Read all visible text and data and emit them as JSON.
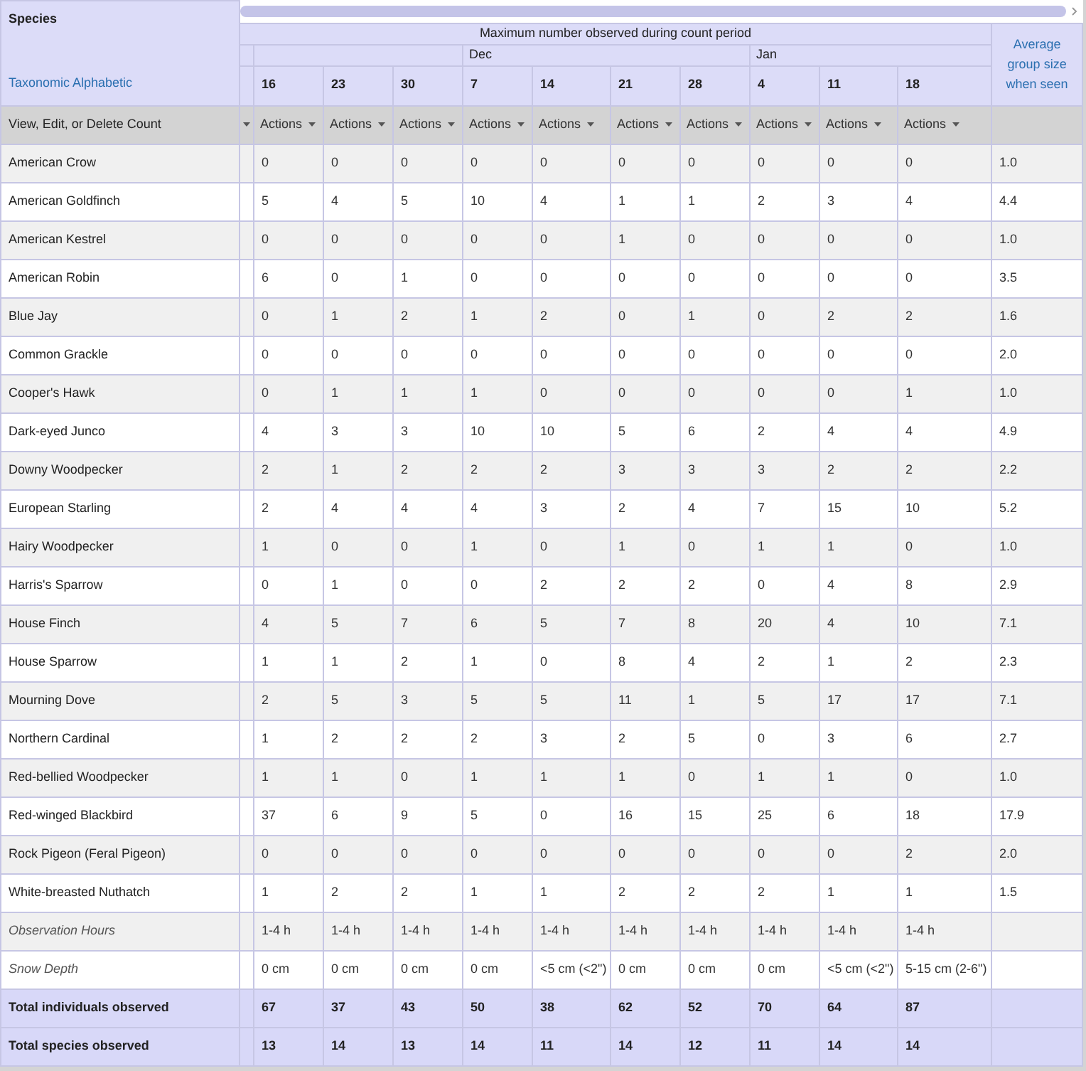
{
  "header": {
    "species_label": "Species",
    "sort_link": "Taxonomic Alphabetic",
    "group_title": "Maximum number observed during count period",
    "date_groups": [
      {
        "dates": [
          "16",
          "23",
          "30"
        ]
      },
      {
        "month": "Dec",
        "dates": [
          "7",
          "14",
          "21",
          "28"
        ]
      },
      {
        "month": "Jan",
        "dates": [
          "4",
          "11",
          "18"
        ]
      }
    ],
    "average_label": "Average group size when seen",
    "actions_label": "View, Edit, or Delete Count",
    "action_buttons": [
      "Actions",
      "Actions",
      "Actions",
      "Actions",
      "Actions",
      "Actions",
      "Actions",
      "Actions",
      "Actions",
      "Actions"
    ]
  },
  "rows": [
    {
      "kind": "species",
      "name": "American Crow",
      "values": [
        "0",
        "0",
        "0",
        "0",
        "0",
        "0",
        "0",
        "0",
        "0",
        "0"
      ],
      "average": "1.0"
    },
    {
      "kind": "species",
      "name": "American Goldfinch",
      "values": [
        "5",
        "4",
        "5",
        "10",
        "4",
        "1",
        "1",
        "2",
        "3",
        "4"
      ],
      "average": "4.4"
    },
    {
      "kind": "species",
      "name": "American Kestrel",
      "values": [
        "0",
        "0",
        "0",
        "0",
        "0",
        "1",
        "0",
        "0",
        "0",
        "0"
      ],
      "average": "1.0"
    },
    {
      "kind": "species",
      "name": "American Robin",
      "values": [
        "6",
        "0",
        "1",
        "0",
        "0",
        "0",
        "0",
        "0",
        "0",
        "0"
      ],
      "average": "3.5"
    },
    {
      "kind": "species",
      "name": "Blue Jay",
      "values": [
        "0",
        "1",
        "2",
        "1",
        "2",
        "0",
        "1",
        "0",
        "2",
        "2"
      ],
      "average": "1.6"
    },
    {
      "kind": "species",
      "name": "Common Grackle",
      "values": [
        "0",
        "0",
        "0",
        "0",
        "0",
        "0",
        "0",
        "0",
        "0",
        "0"
      ],
      "average": "2.0"
    },
    {
      "kind": "species",
      "name": "Cooper's Hawk",
      "values": [
        "0",
        "1",
        "1",
        "1",
        "0",
        "0",
        "0",
        "0",
        "0",
        "1"
      ],
      "average": "1.0"
    },
    {
      "kind": "species",
      "name": "Dark-eyed Junco",
      "values": [
        "4",
        "3",
        "3",
        "10",
        "10",
        "5",
        "6",
        "2",
        "4",
        "4"
      ],
      "average": "4.9"
    },
    {
      "kind": "species",
      "name": "Downy Woodpecker",
      "values": [
        "2",
        "1",
        "2",
        "2",
        "2",
        "3",
        "3",
        "3",
        "2",
        "2"
      ],
      "average": "2.2"
    },
    {
      "kind": "species",
      "name": "European Starling",
      "values": [
        "2",
        "4",
        "4",
        "4",
        "3",
        "2",
        "4",
        "7",
        "15",
        "10"
      ],
      "average": "5.2"
    },
    {
      "kind": "species",
      "name": "Hairy Woodpecker",
      "values": [
        "1",
        "0",
        "0",
        "1",
        "0",
        "1",
        "0",
        "1",
        "1",
        "0"
      ],
      "average": "1.0"
    },
    {
      "kind": "species",
      "name": "Harris's Sparrow",
      "values": [
        "0",
        "1",
        "0",
        "0",
        "2",
        "2",
        "2",
        "0",
        "4",
        "8"
      ],
      "average": "2.9"
    },
    {
      "kind": "species",
      "name": "House Finch",
      "values": [
        "4",
        "5",
        "7",
        "6",
        "5",
        "7",
        "8",
        "20",
        "4",
        "10"
      ],
      "average": "7.1"
    },
    {
      "kind": "species",
      "name": "House Sparrow",
      "values": [
        "1",
        "1",
        "2",
        "1",
        "0",
        "8",
        "4",
        "2",
        "1",
        "2"
      ],
      "average": "2.3"
    },
    {
      "kind": "species",
      "name": "Mourning Dove",
      "values": [
        "2",
        "5",
        "3",
        "5",
        "5",
        "11",
        "1",
        "5",
        "17",
        "17"
      ],
      "average": "7.1"
    },
    {
      "kind": "species",
      "name": "Northern Cardinal",
      "values": [
        "1",
        "2",
        "2",
        "2",
        "3",
        "2",
        "5",
        "0",
        "3",
        "6"
      ],
      "average": "2.7"
    },
    {
      "kind": "species",
      "name": "Red-bellied Woodpecker",
      "values": [
        "1",
        "1",
        "0",
        "1",
        "1",
        "1",
        "0",
        "1",
        "1",
        "0"
      ],
      "average": "1.0"
    },
    {
      "kind": "species",
      "name": "Red-winged Blackbird",
      "values": [
        "37",
        "6",
        "9",
        "5",
        "0",
        "16",
        "15",
        "25",
        "6",
        "18"
      ],
      "average": "17.9"
    },
    {
      "kind": "species",
      "name": "Rock Pigeon (Feral Pigeon)",
      "values": [
        "0",
        "0",
        "0",
        "0",
        "0",
        "0",
        "0",
        "0",
        "0",
        "2"
      ],
      "average": "2.0"
    },
    {
      "kind": "species",
      "name": "White-breasted Nuthatch",
      "values": [
        "1",
        "2",
        "2",
        "1",
        "1",
        "2",
        "2",
        "2",
        "1",
        "1"
      ],
      "average": "1.5"
    },
    {
      "kind": "info",
      "name": "Observation Hours",
      "values": [
        "1-4 h",
        "1-4 h",
        "1-4 h",
        "1-4 h",
        "1-4 h",
        "1-4 h",
        "1-4 h",
        "1-4 h",
        "1-4 h",
        "1-4 h"
      ]
    },
    {
      "kind": "info",
      "name": "Snow Depth",
      "values": [
        "0 cm",
        "0 cm",
        "0 cm",
        "0 cm",
        "<5 cm (<2\")",
        "0 cm",
        "0 cm",
        "0 cm",
        "<5 cm (<2\")",
        "5-15 cm (2-6\")"
      ]
    },
    {
      "kind": "total",
      "name": "Total individuals observed",
      "values": [
        "67",
        "37",
        "43",
        "50",
        "38",
        "62",
        "52",
        "70",
        "64",
        "87"
      ]
    },
    {
      "kind": "total",
      "name": "Total species observed",
      "values": [
        "13",
        "14",
        "13",
        "14",
        "11",
        "14",
        "12",
        "11",
        "14",
        "14"
      ]
    }
  ]
}
